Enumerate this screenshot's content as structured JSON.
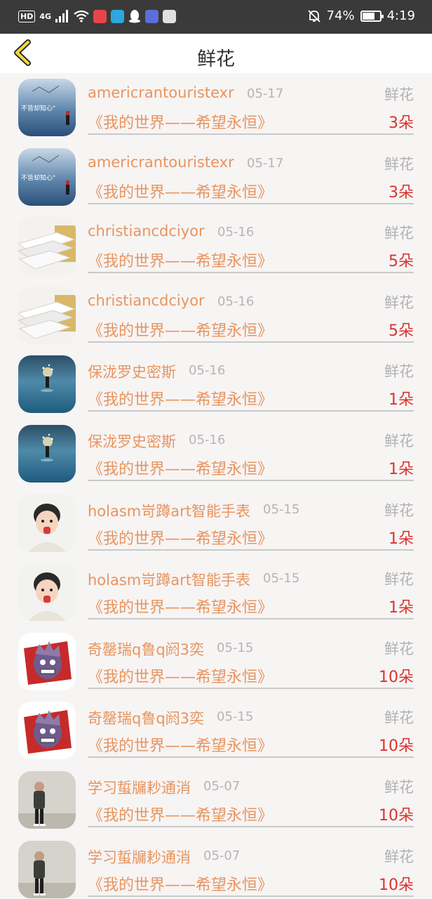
{
  "status_bar": {
    "hd": "HD",
    "network": "4G",
    "battery": "74%",
    "battery_level": 0.74,
    "time": "4:19"
  },
  "header": {
    "title": "鲜花"
  },
  "gifts": [
    {
      "user": "americrantouristexr",
      "date": "05-17",
      "type": "鲜花",
      "title": "《我的世界——希望永恒》",
      "count": "3朵",
      "avatar": "sea-text",
      "avatar_text": "不皆却知心\""
    },
    {
      "user": "americrantouristexr",
      "date": "05-17",
      "type": "鲜花",
      "title": "《我的世界——希望永恒》",
      "count": "3朵",
      "avatar": "sea-text",
      "avatar_text": "不皆却知心\""
    },
    {
      "user": "christiancdciyor",
      "date": "05-16",
      "type": "鲜花",
      "title": "《我的世界——希望永恒》",
      "count": "5朵",
      "avatar": "books"
    },
    {
      "user": "christiancdciyor",
      "date": "05-16",
      "type": "鲜花",
      "title": "《我的世界——希望永恒》",
      "count": "5朵",
      "avatar": "books"
    },
    {
      "user": "保泷罗史密斯",
      "date": "05-16",
      "type": "鲜花",
      "title": "《我的世界——希望永恒》",
      "count": "1朵",
      "avatar": "sea-figure"
    },
    {
      "user": "保泷罗史密斯",
      "date": "05-16",
      "type": "鲜花",
      "title": "《我的世界——希望永恒》",
      "count": "1朵",
      "avatar": "sea-figure"
    },
    {
      "user": "holasm岢蹲art智能手表",
      "date": "05-15",
      "type": "鲜花",
      "title": "《我的世界——希望永恒》",
      "count": "1朵",
      "avatar": "child"
    },
    {
      "user": "holasm岢蹲art智能手表",
      "date": "05-15",
      "type": "鲜花",
      "title": "《我的世界——希望永恒》",
      "count": "1朵",
      "avatar": "child"
    },
    {
      "user": "奇罄瑞q鲁q阏3奕",
      "date": "05-15",
      "type": "鲜花",
      "title": "《我的世界——希望永恒》",
      "count": "10朵",
      "avatar": "cartoon"
    },
    {
      "user": "奇罄瑞q鲁q阏3奕",
      "date": "05-15",
      "type": "鲜花",
      "title": "《我的世界——希望永恒》",
      "count": "10朵",
      "avatar": "cartoon"
    },
    {
      "user": "学习蜇牖耖通消",
      "date": "05-07",
      "type": "鲜花",
      "title": "《我的世界——希望永恒》",
      "count": "10朵",
      "avatar": "person"
    },
    {
      "user": "学习蜇牖耖通消",
      "date": "05-07",
      "type": "鲜花",
      "title": "《我的世界——希望永恒》",
      "count": "10朵",
      "avatar": "person"
    }
  ]
}
